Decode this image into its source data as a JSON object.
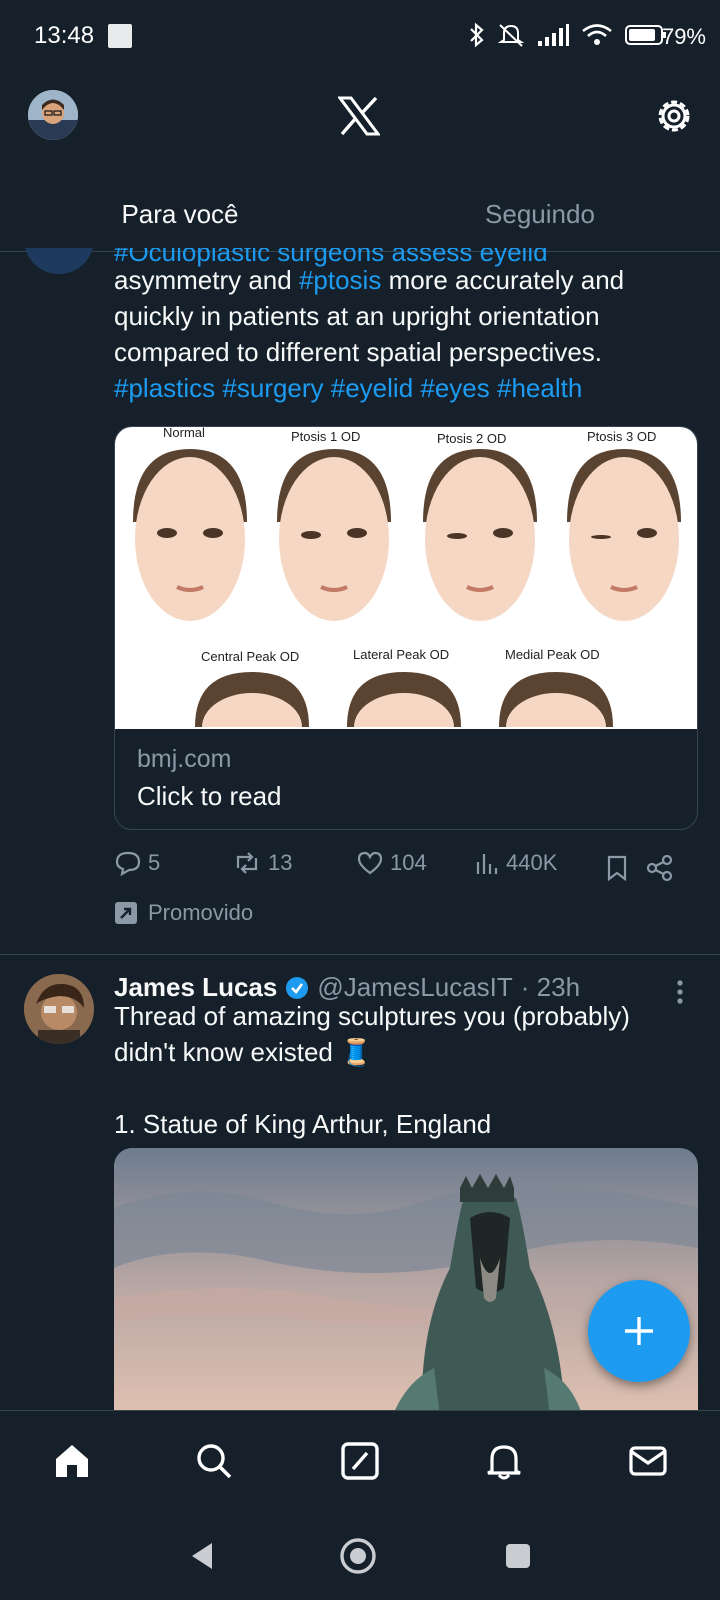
{
  "status_bar": {
    "time": "13:48",
    "battery": "79%"
  },
  "tabs": [
    {
      "label": "Para você",
      "active": true
    },
    {
      "label": "Seguindo",
      "active": false
    }
  ],
  "tweet1": {
    "cut_line": "#Oculoplastic surgeons assess eyelid",
    "line1_pre": "asymmetry and ",
    "line1_tag": "#ptosis",
    "line1_post": " more accurately and",
    "line2": "quickly in patients at an upright orientation",
    "line3": "compared to different spatial perspectives.",
    "hashtags": "#plastics #surgery #eyelid #eyes #health",
    "card": {
      "image_labels": [
        "Normal",
        "Ptosis 1 OD",
        "Ptosis 2 OD",
        "Ptosis 3 OD",
        "Central Peak OD",
        "Lateral Peak OD",
        "Medial Peak OD"
      ],
      "domain": "bmj.com",
      "title": "Click to read"
    },
    "actions": {
      "replies": "5",
      "retweets": "13",
      "likes": "104",
      "views": "440K"
    },
    "promoted_label": "Promovido"
  },
  "tweet2": {
    "name": "James Lucas",
    "handle": "@JamesLucasIT",
    "time": "· 23h",
    "line1": "Thread of amazing sculptures you (probably)",
    "line2": "didn't know existed 🧵",
    "line3": "1. Statue of King Arthur, England"
  },
  "colors": {
    "background": "#15202b",
    "accent": "#1d9bf0",
    "muted": "#8b98a5",
    "border": "#38444d"
  },
  "icons": {
    "nav": [
      "home-icon",
      "search-icon",
      "compose-icon",
      "notifications-icon",
      "messages-icon"
    ],
    "system": [
      "back-icon",
      "home-circle-icon",
      "recents-icon"
    ]
  }
}
